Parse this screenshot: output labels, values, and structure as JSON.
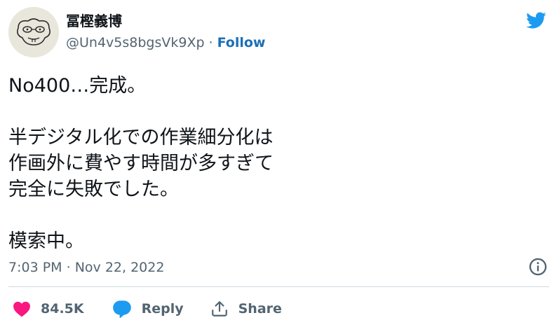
{
  "author": {
    "display_name": "冨樫義博",
    "handle": "@Un4v5s8bgsVk9Xp",
    "separator": "·",
    "follow_label": "Follow"
  },
  "tweet": {
    "text": "No400…完成。\n\n半デジタル化での作業細分化は\n作画外に費やす時間が多すぎて\n完全に失敗でした。\n\n模索中。",
    "time": "7:03 PM",
    "meta_separator": "·",
    "date": "Nov 22, 2022"
  },
  "actions": {
    "like_count": "84.5K",
    "reply_label": "Reply",
    "share_label": "Share"
  },
  "icons": {
    "logo": "twitter-bird-icon",
    "like": "heart-icon",
    "reply": "speech-bubble-icon",
    "share": "share-icon",
    "info": "info-icon"
  },
  "colors": {
    "brand": "#1d9bf0",
    "like": "#f91880",
    "follow": "#1d6fb8",
    "secondary_text": "#536471",
    "divider": "#cfd9de"
  }
}
